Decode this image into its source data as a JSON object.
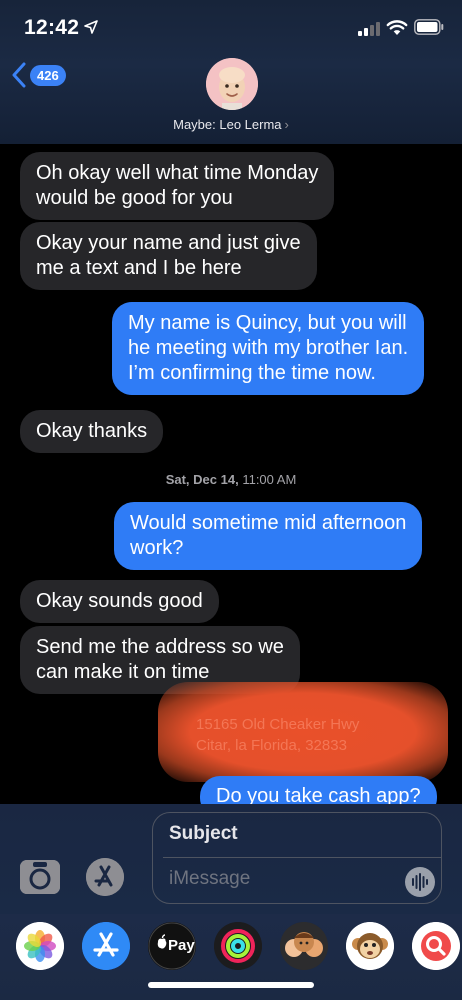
{
  "status_bar": {
    "time": "12:42"
  },
  "header": {
    "back_count": "426",
    "contact_name": "Maybe: Leo Lerma",
    "chevron": "›"
  },
  "messages": [
    {
      "side": "in",
      "text": "Oh okay well what time Monday\nwould be good for you"
    },
    {
      "side": "in",
      "text": "Okay your name and just give\nme a text and I be here"
    },
    {
      "side": "out",
      "text": "My name is Quincy, but you will\nhe meeting with my brother Ian.\nI’m confirming the time now."
    },
    {
      "side": "in",
      "text": "Okay thanks"
    },
    {
      "side": "out",
      "text": "Would sometime mid afternoon\nwork?"
    },
    {
      "side": "in",
      "text": "Okay sounds good"
    },
    {
      "side": "in",
      "text": "Send me the address so we\ncan make it on time"
    },
    {
      "side": "out",
      "text": "Do you take cash app?"
    }
  ],
  "timestamp": {
    "day": "Sat, Dec 14,",
    "time": "11:00 AM"
  },
  "redacted_text": "15165 Old Cheaker Hwy\nCitar, la Florida, 32833",
  "compose": {
    "subject_placeholder": "Subject",
    "message_placeholder": "iMessage"
  },
  "apps": {
    "photos": "photos-icon",
    "appstore": "app-store-icon",
    "applepay": "Pay",
    "activity": "activity-icon",
    "memoji": "memoji-icon",
    "animoji": "animoji-icon",
    "search": "search-icon"
  },
  "colors": {
    "outgoing_bubble": "#2f7cf6",
    "incoming_bubble": "#262629",
    "header_bg": "#1b2a44",
    "redaction": "#e5502b"
  }
}
